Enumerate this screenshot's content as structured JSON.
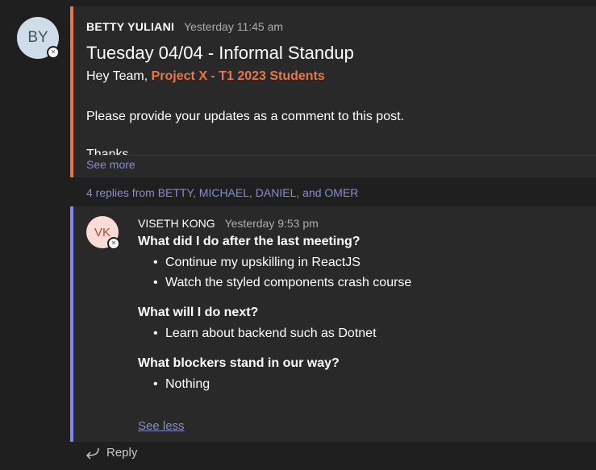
{
  "post": {
    "avatar_initials": "BY",
    "author": "BETTY YULIANI",
    "timestamp": "Yesterday 11:45 am",
    "subject": "Tuesday 04/04 - Informal Standup",
    "greeting": "Hey Team, ",
    "mention": "Project X - T1 2023 Students",
    "body_line": "Please provide your updates as a comment to this post.",
    "truncated_line": "Thanks",
    "see_more": "See more",
    "accent_color": "#e97548"
  },
  "replies_summary": "4 replies from BETTY, MICHAEL, DANIEL, and OMER",
  "reply": {
    "avatar_initials": "VK",
    "author": "VISETH KONG",
    "timestamp": "Yesterday 9:53 pm",
    "sections": [
      {
        "question": "What did I do after the last meeting?",
        "bullets": [
          "Continue my upskilling in ReactJS",
          "Watch the styled components crash course"
        ]
      },
      {
        "question": "What will I do next?",
        "bullets": [
          "Learn about backend such as Dotnet"
        ]
      },
      {
        "question": "What blockers stand in our way?",
        "bullets": [
          "Nothing"
        ]
      }
    ],
    "see_less": "See less",
    "accent_color": "#7f85f5"
  },
  "reply_action": {
    "label": "Reply",
    "icon": "reply-arrow-icon"
  }
}
